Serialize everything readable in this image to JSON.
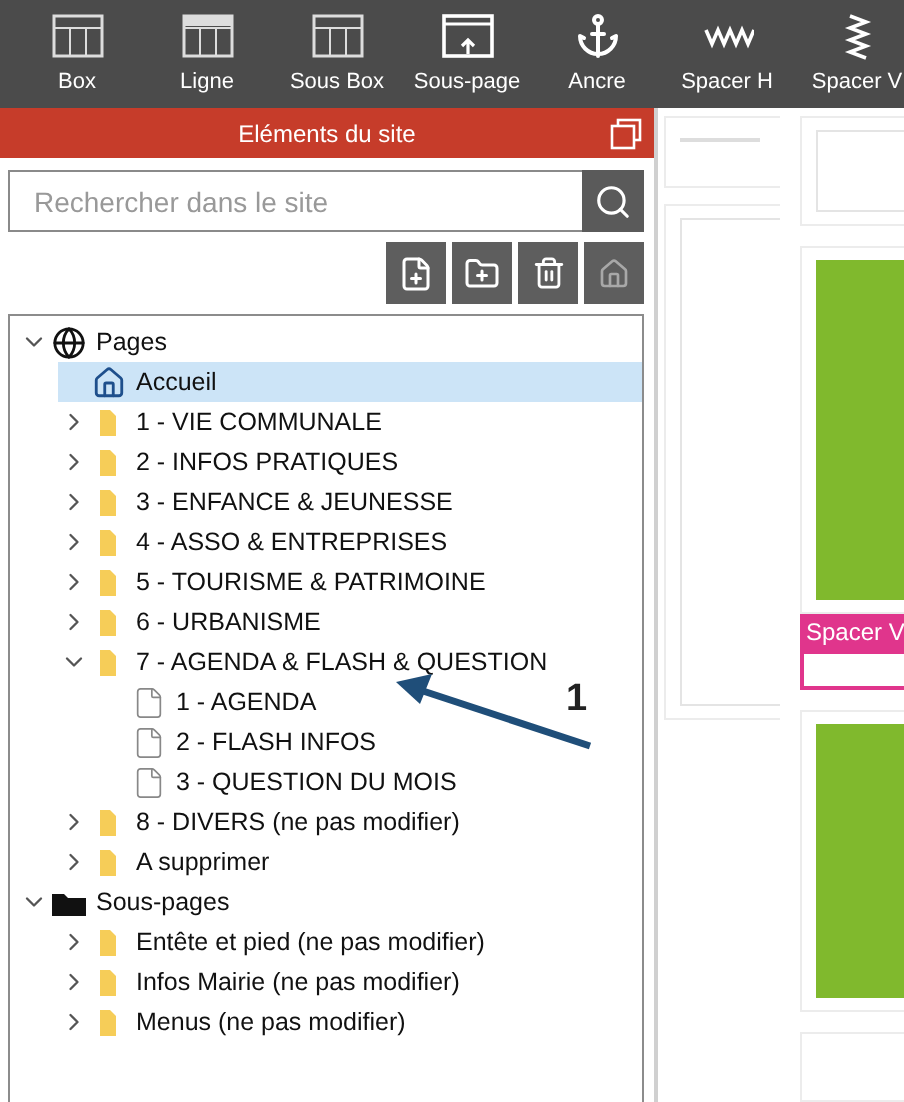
{
  "toolbar": [
    {
      "kind": "box",
      "label": "Box"
    },
    {
      "kind": "row",
      "label": "Ligne"
    },
    {
      "kind": "subbox",
      "label": "Sous Box"
    },
    {
      "kind": "subpage",
      "label": "Sous-page"
    },
    {
      "kind": "anchor",
      "label": "Ancre"
    },
    {
      "kind": "spacer-h",
      "label": "Spacer H"
    },
    {
      "kind": "spacer-v",
      "label": "Spacer V"
    }
  ],
  "panel": {
    "title": "Eléments du site",
    "search": {
      "placeholder": "Rechercher dans le site"
    },
    "actions": [
      {
        "kind": "new-page",
        "disabled": false
      },
      {
        "kind": "new-folder",
        "disabled": false
      },
      {
        "kind": "delete",
        "disabled": false
      },
      {
        "kind": "home",
        "disabled": true
      }
    ],
    "tree": [
      {
        "kind": "globe",
        "label": "Pages",
        "expanded": true,
        "selected": false,
        "children": [
          {
            "kind": "home",
            "label": "Accueil",
            "selected": true
          },
          {
            "kind": "folder",
            "label": "1 - VIE COMMUNALE",
            "expanded": false,
            "selected": false
          },
          {
            "kind": "folder",
            "label": "2 - INFOS PRATIQUES",
            "expanded": false,
            "selected": false
          },
          {
            "kind": "folder",
            "label": "3 - ENFANCE & JEUNESSE",
            "expanded": false,
            "selected": false
          },
          {
            "kind": "folder",
            "label": "4 - ASSO & ENTREPRISES",
            "expanded": false,
            "selected": false
          },
          {
            "kind": "folder",
            "label": "5 - TOURISME & PATRIMOINE",
            "expanded": false,
            "selected": false
          },
          {
            "kind": "folder",
            "label": "6 - URBANISME",
            "expanded": false,
            "selected": false
          },
          {
            "kind": "folder",
            "label": "7 - AGENDA & FLASH & QUESTION",
            "expanded": true,
            "selected": false,
            "children": [
              {
                "kind": "page",
                "label": "1 - AGENDA",
                "selected": false
              },
              {
                "kind": "page",
                "label": "2 - FLASH INFOS",
                "selected": false
              },
              {
                "kind": "page",
                "label": "3 - QUESTION DU MOIS",
                "selected": false
              }
            ]
          },
          {
            "kind": "folder",
            "label": "8 - DIVERS (ne pas modifier)",
            "expanded": false,
            "selected": false
          },
          {
            "kind": "folder",
            "label": "A supprimer",
            "expanded": false,
            "selected": false
          }
        ]
      },
      {
        "kind": "dark-folder",
        "label": "Sous-pages",
        "expanded": true,
        "selected": false,
        "children": [
          {
            "kind": "folder",
            "label": "Entête et pied (ne pas modifier)",
            "expanded": false,
            "selected": false
          },
          {
            "kind": "folder",
            "label": "Infos Mairie (ne pas modifier)",
            "expanded": false,
            "selected": false
          },
          {
            "kind": "folder",
            "label": "Menus (ne pas modifier)",
            "expanded": false,
            "selected": false
          }
        ]
      }
    ]
  },
  "annotation": {
    "label": "1"
  },
  "canvas": {
    "spacer_label": "Spacer V"
  }
}
